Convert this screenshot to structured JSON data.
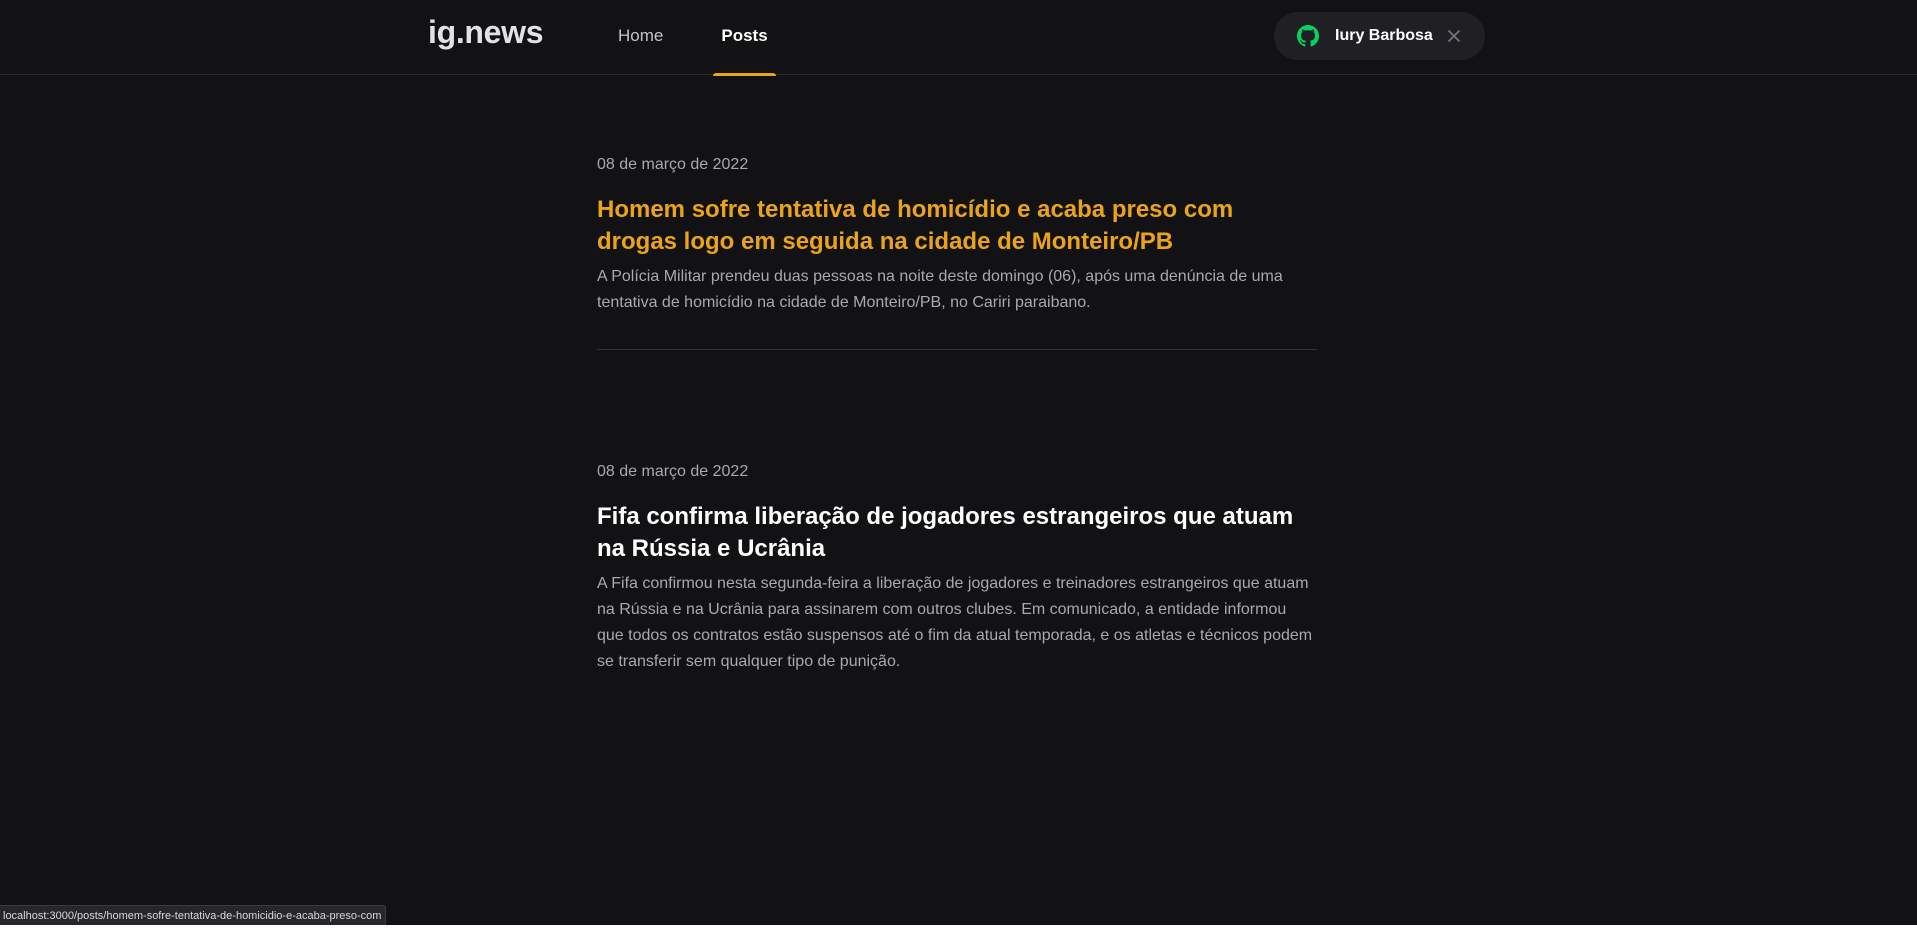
{
  "header": {
    "logo": "ig.news",
    "nav": [
      {
        "label": "Home",
        "active": false
      },
      {
        "label": "Posts",
        "active": true
      }
    ],
    "user": {
      "name": "Iury Barbosa",
      "icon": "github-icon",
      "close_icon": "close-icon",
      "github_icon_color": "#04d361"
    }
  },
  "posts": [
    {
      "date": "08 de março de 2022",
      "title": "Homem sofre tentativa de homicídio e acaba preso com drogas logo em seguida na cidade de Monteiro/PB",
      "excerpt": "A Polícia Militar prendeu duas pessoas na noite deste domingo (06), após uma denúncia de uma tentativa de homicídio na cidade de Monteiro/PB, no Cariri paraibano."
    },
    {
      "date": "08 de março de 2022",
      "title": "Fifa confirma liberação de jogadores estrangeiros que atuam na Rússia e Ucrânia",
      "excerpt": "A Fifa confirmou nesta segunda-feira a liberação de jogadores e treinadores estrangeiros que atuam na Rússia e na Ucrânia para assinarem com outros clubes. Em comunicado, a entidade informou que todos os contratos estão suspensos até o fim da atual temporada, e os atletas e técnicos podem se transferir sem qualquer tipo de punição."
    }
  ],
  "status_bar": {
    "url": "localhost:3000/posts/homem-sofre-tentativa-de-homicidio-e-acaba-preso-com"
  },
  "colors": {
    "background": "#121214",
    "accent": "#eba417",
    "text": "#e1e1e6",
    "muted": "#a8a8b3"
  }
}
